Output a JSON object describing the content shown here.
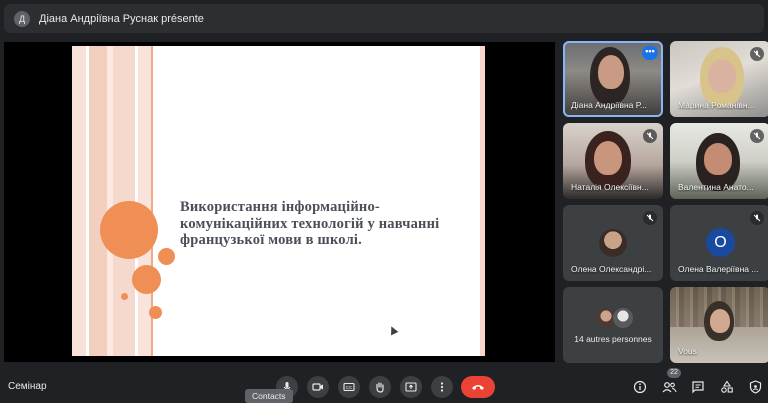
{
  "presenter": {
    "avatar_letter": "Д",
    "text": "Діана Андріївна Руснак présente"
  },
  "slide": {
    "title": "Використання інформаційно-комунікаційних технологій у навчанні французької мови в школі."
  },
  "participants": [
    {
      "name": "Діана Андріївна Р...",
      "more": "•••",
      "style": "photo",
      "active": true
    },
    {
      "name": "Марина Романівн...",
      "style": "photo",
      "muted": true
    },
    {
      "name": "Наталія Олексіївн...",
      "style": "photo",
      "muted": true
    },
    {
      "name": "Валентина Анато...",
      "style": "photo",
      "muted": true
    },
    {
      "name": "Олена Олександрі...",
      "style": "small-photo",
      "muted": true
    },
    {
      "name": "Олена Валеріївна ...",
      "style": "letter",
      "avatar_letter": "О",
      "muted": true
    },
    {
      "others_text": "14 autres personnes"
    },
    {
      "name": "Vous",
      "style": "photo"
    }
  ],
  "bottom_bar": {
    "meeting_name": "Семінар",
    "participant_count": "22",
    "tooltip": "Contacts"
  },
  "colors": {
    "accent": "#ef8f56",
    "hangup": "#ea4335",
    "active_outline": "#8ab4f8",
    "letter_avatar": "#1a4aa0"
  },
  "icons": [
    "mic-off-icon",
    "more-vert-icon",
    "microphone-icon",
    "camera-icon",
    "captions-icon",
    "hand-icon",
    "present-icon",
    "hangup-icon",
    "info-icon",
    "people-icon",
    "chat-icon",
    "activities-icon",
    "shield-icon"
  ]
}
